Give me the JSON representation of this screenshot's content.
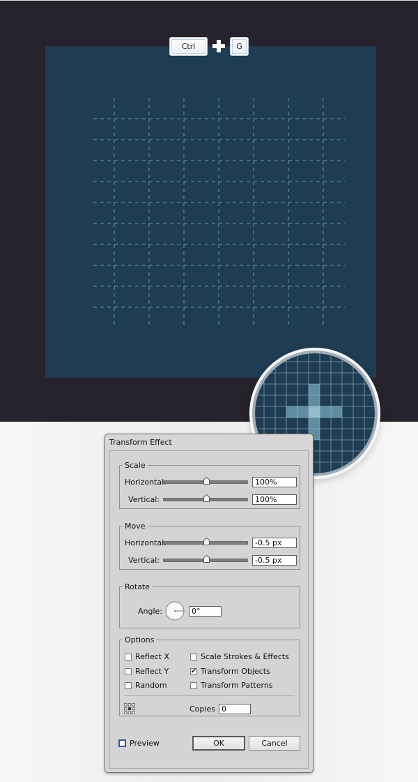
{
  "shortcut": {
    "keys": [
      "Ctrl",
      "G"
    ],
    "combiner": "+"
  },
  "artboard": {
    "background_color": "#1e3c52",
    "guide_color": "#8fb4c7",
    "guide_columns": 7,
    "guide_rows": 10,
    "guide_style": "dashed"
  },
  "magnifier": {
    "grid_color": "#9ab7c8",
    "plus_color": "#5f8ea3",
    "plus_center_color": "#94bccb"
  },
  "dialog": {
    "title": "Transform Effect",
    "scale": {
      "legend": "Scale",
      "horizontal_label": "Horizontal:",
      "horizontal_value": "100%",
      "horizontal_slider_fraction": 0.5,
      "vertical_label": "Vertical:",
      "vertical_value": "100%",
      "vertical_slider_fraction": 0.5
    },
    "move": {
      "legend": "Move",
      "horizontal_label": "Horizontal:",
      "horizontal_value": "-0.5 px",
      "horizontal_slider_fraction": 0.5,
      "vertical_label": "Vertical:",
      "vertical_value": "-0.5 px",
      "vertical_slider_fraction": 0.5
    },
    "rotate": {
      "legend": "Rotate",
      "angle_label": "Angle:",
      "angle_value": "0°"
    },
    "options": {
      "legend": "Options",
      "checkboxes": [
        {
          "label": "Reflect X",
          "checked": false
        },
        {
          "label": "Reflect Y",
          "checked": false
        },
        {
          "label": "Random",
          "checked": false
        },
        {
          "label": "Scale Strokes & Effects",
          "checked": false
        },
        {
          "label": "Transform Objects",
          "checked": true
        },
        {
          "label": "Transform Patterns",
          "checked": false
        }
      ],
      "reference_point_icon": "reference-point-locator",
      "copies_label": "Copies",
      "copies_value": "0"
    },
    "preview_label": "Preview",
    "preview_checked": false,
    "ok_label": "OK",
    "cancel_label": "Cancel"
  }
}
